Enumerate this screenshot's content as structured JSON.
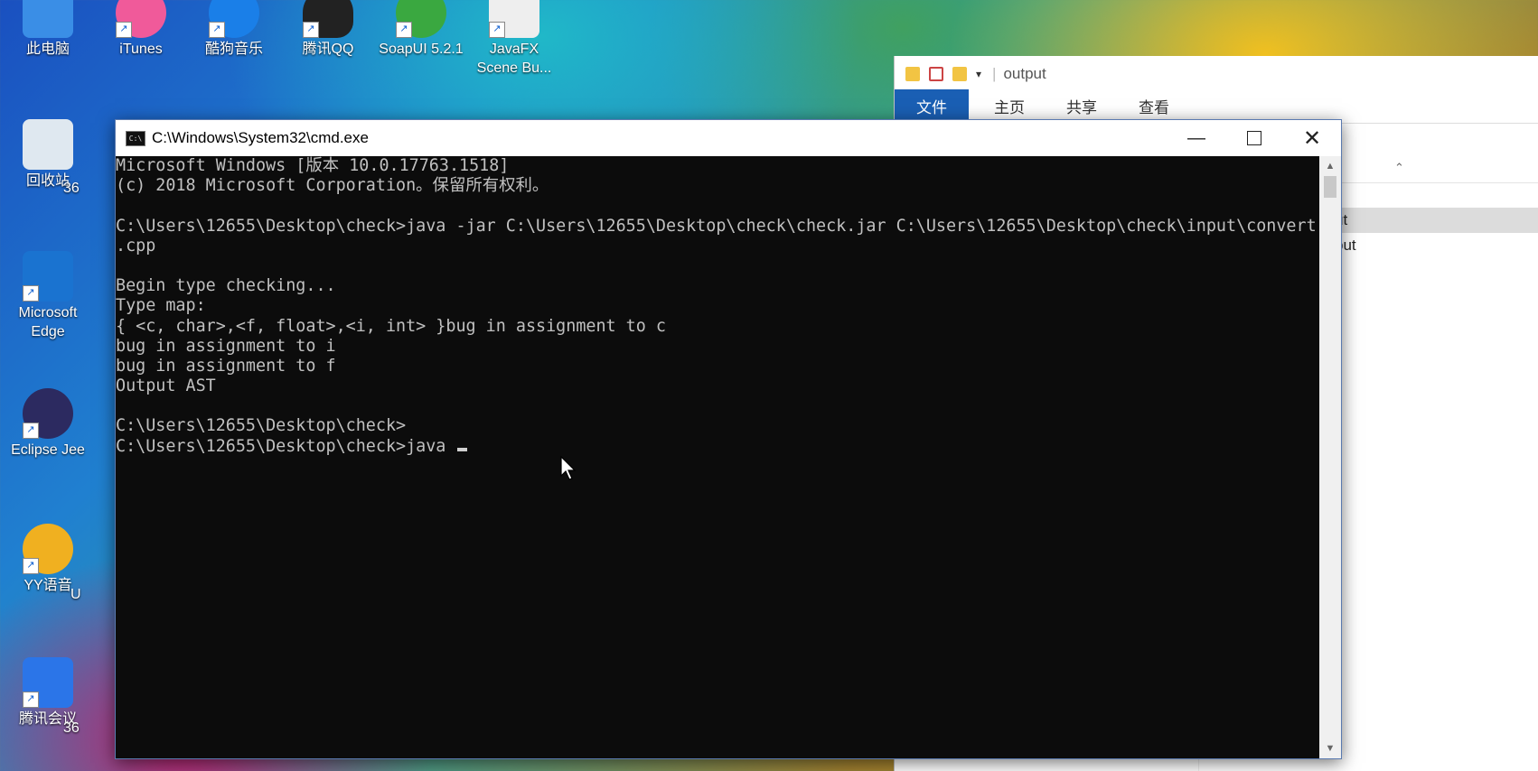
{
  "desktop": {
    "icons": [
      {
        "label": "此电脑",
        "color": "#3a8ee6"
      },
      {
        "label": "iTunes",
        "color": "#f05a9a"
      },
      {
        "label": "酷狗音乐",
        "color": "#1a7fe8"
      },
      {
        "label": "腾讯QQ",
        "color": "#222222"
      },
      {
        "label": "SoapUI 5.2.1",
        "color": "#3aa840"
      },
      {
        "label": "JavaFX\nScene Bu...",
        "color": "#eeeeee"
      },
      {
        "label": "回收站",
        "color": "#dfe8f0"
      },
      {
        "label": "Microsoft\nEdge",
        "color": "#1a73d0"
      },
      {
        "label": "Eclipse Jee",
        "color": "#2c2a60"
      },
      {
        "label": "YY语音",
        "color": "#f0b020"
      },
      {
        "label": "腾讯会议",
        "color": "#2b75e8"
      }
    ],
    "partial_labels": [
      "36",
      "36",
      "U"
    ]
  },
  "explorer": {
    "title": "output",
    "ribbon_tabs": [
      "文件",
      "主页",
      "共享",
      "查看"
    ],
    "list_items": [
      "ut",
      "put"
    ]
  },
  "cmd": {
    "title": "C:\\Windows\\System32\\cmd.exe",
    "icon_text": "C:\\",
    "lines": [
      "Microsoft Windows [版本 10.0.17763.1518]",
      "(c) 2018 Microsoft Corporation。保留所有权利。",
      "",
      "C:\\Users\\12655\\Desktop\\check>java -jar C:\\Users\\12655\\Desktop\\check\\check.jar C:\\Users\\12655\\Desktop\\check\\input\\convert",
      ".cpp",
      "",
      "Begin type checking...",
      "Type map:",
      "{ <c, char>,<f, float>,<i, int> }bug in assignment to c",
      "bug in assignment to i",
      "bug in assignment to f",
      "Output AST",
      "",
      "C:\\Users\\12655\\Desktop\\check>",
      "C:\\Users\\12655\\Desktop\\check>java "
    ]
  }
}
